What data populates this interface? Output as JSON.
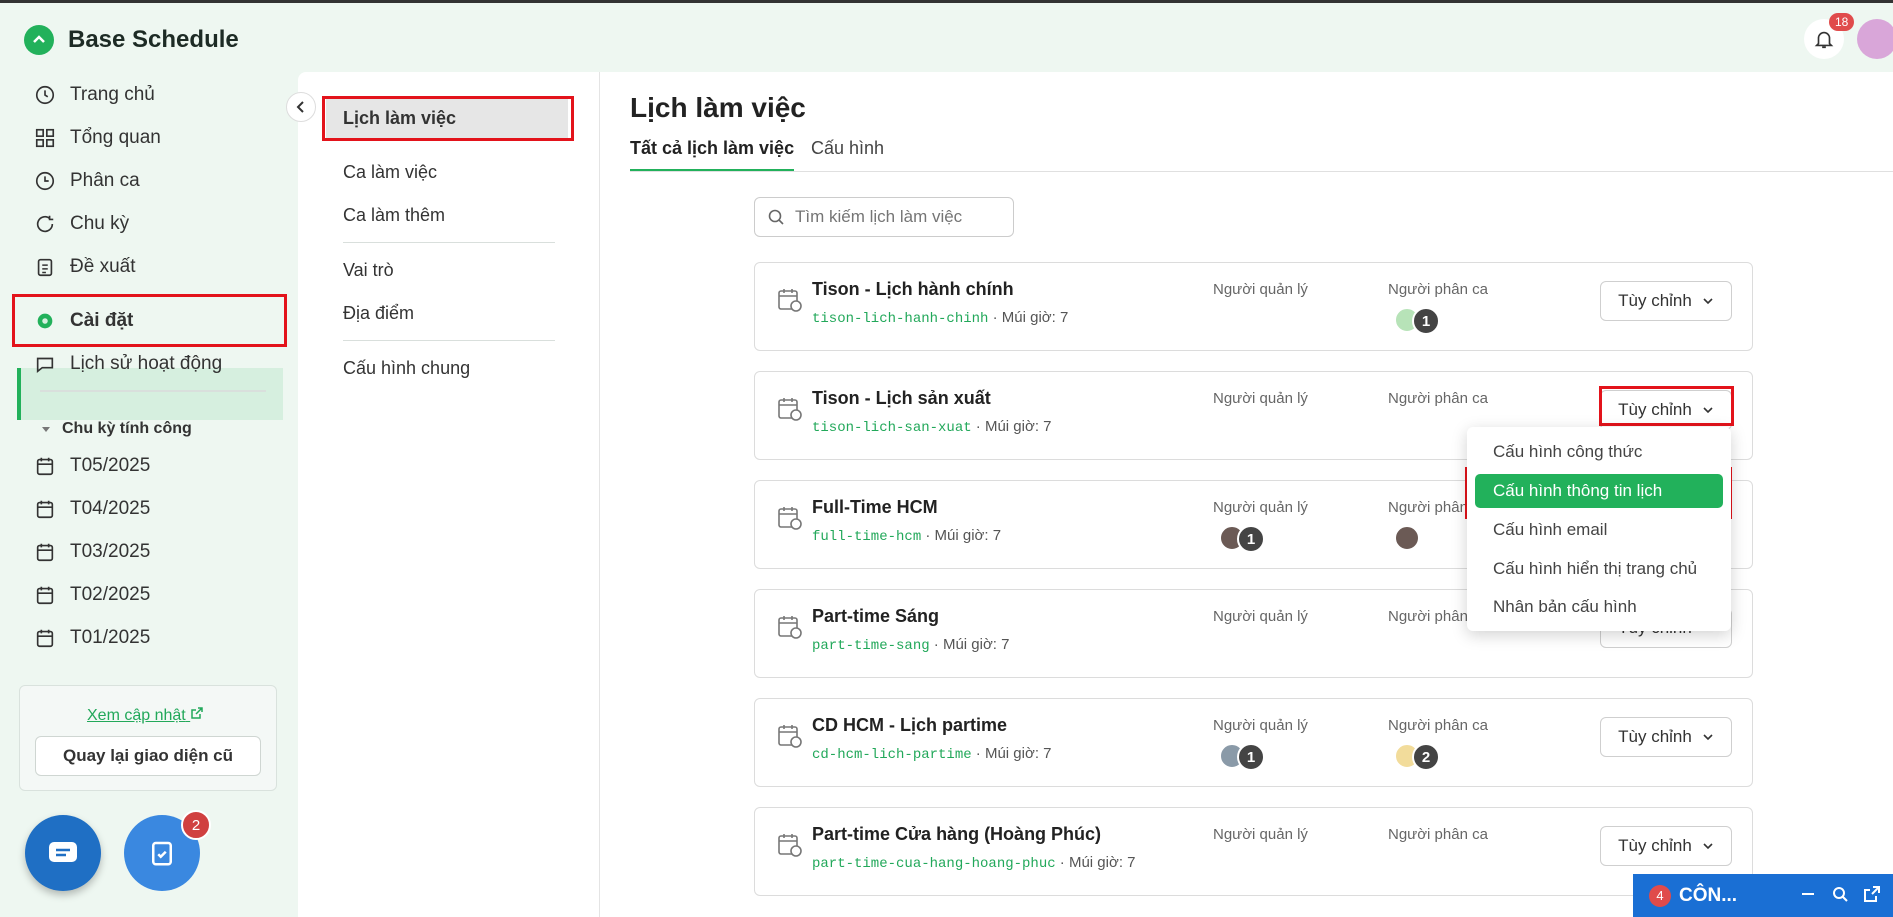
{
  "app": {
    "title": "Base Schedule",
    "accent": "#22b15b"
  },
  "header": {
    "notification_count": "18"
  },
  "sidebar": {
    "items": [
      {
        "label": "Trang chủ",
        "icon": "clock-icon"
      },
      {
        "label": "Tổng quan",
        "icon": "grid-icon"
      },
      {
        "label": "Phân ca",
        "icon": "clock-arrow-icon"
      },
      {
        "label": "Chu kỳ",
        "icon": "cycle-icon"
      },
      {
        "label": "Đề xuất",
        "icon": "clipboard-icon"
      },
      {
        "label": "Cài đặt",
        "icon": "gear-icon",
        "active": true
      },
      {
        "label": "Lịch sử hoạt động",
        "icon": "chat-icon"
      }
    ],
    "period_section_title": "Chu kỳ tính công",
    "periods": [
      "T05/2025",
      "T04/2025",
      "T03/2025",
      "T02/2025",
      "T01/2025"
    ],
    "update_link": "Xem cập nhật",
    "back_button": "Quay lại giao diện cũ",
    "task_badge": "2"
  },
  "submenu": {
    "items": [
      "Lịch làm việc",
      "Ca làm việc",
      "Ca làm thêm",
      "Vai trò",
      "Địa điểm",
      "Cấu hình chung"
    ]
  },
  "main": {
    "title": "Lịch làm việc",
    "tabs": [
      "Tất cả lịch làm việc",
      "Cấu hình"
    ],
    "search_placeholder": "Tìm kiếm lịch làm việc",
    "label_manager": "Người quản lý",
    "label_assigner": "Người phân ca",
    "button_label": "Tùy chỉnh",
    "schedules": [
      {
        "name": "Tison - Lịch hành chính",
        "code": "tison-lich-hanh-chinh",
        "tz": " · Múi giờ: 7",
        "assigner_count": "1"
      },
      {
        "name": "Tison - Lịch sản xuất",
        "code": "tison-lich-san-xuat",
        "tz": " · Múi giờ: 7"
      },
      {
        "name": "Full-Time HCM",
        "code": "full-time-hcm",
        "tz": " · Múi giờ: 7",
        "manager_count": "1"
      },
      {
        "name": "Part-time Sáng",
        "code": "part-time-sang",
        "tz": " · Múi giờ: 7"
      },
      {
        "name": "CD HCM - Lịch partime",
        "code": "cd-hcm-lich-partime",
        "tz": " · Múi giờ: 7",
        "manager_count": "1",
        "assigner_count": "2"
      },
      {
        "name": "Part-time Cửa hàng (Hoàng Phúc)",
        "code": "part-time-cua-hang-hoang-phuc",
        "tz": " · Múi giờ: 7"
      }
    ]
  },
  "dropdown": {
    "items": [
      "Cấu hình công thức",
      "Cấu hình thông tin lịch",
      "Cấu hình email",
      "Cấu hình hiển thị trang chủ",
      "Nhân bản cấu hình"
    ]
  },
  "chat": {
    "badge": "4",
    "title": "CÔN..."
  }
}
